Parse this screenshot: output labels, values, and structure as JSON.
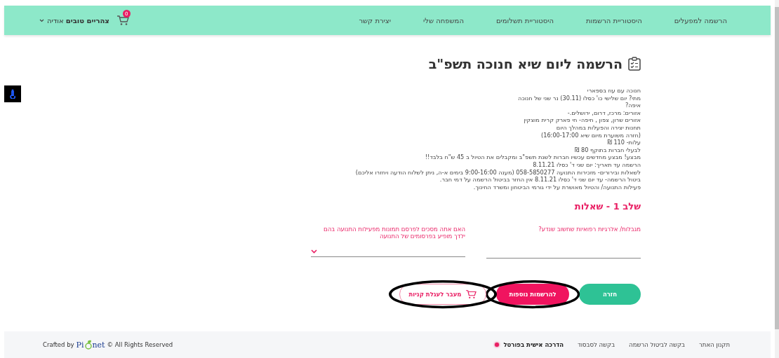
{
  "nav": {
    "items": [
      {
        "label": "הרשמה למפעלים"
      },
      {
        "label": "היסטוריית הרשמות"
      },
      {
        "label": "היסטוריית תשלומים"
      },
      {
        "label": "המשפחה שלי"
      },
      {
        "label": "יצירת קשר"
      }
    ],
    "cart_count": "0",
    "user": {
      "bold": "צהריים טובים",
      "name": "אודיה"
    }
  },
  "title": "הרשמה ליום שיא חנוכה תשפ\"ב",
  "description": [
    "חנוכה עם עוז בספארי",
    "מתי? יום שלישי כו' כסלו (30.11) נר שני של חנוכה",
    "איפה?",
    "אזורים: מרכז, דרום, ירושלים.-",
    "אזורים שרון, צפון , חיפה- חי פארק קרית מוצקין",
    "תחנות יצירה והפעלות במהלך היום",
    "(חזרה משוערת מיום שיא 16:00-17:00)",
    "עלות- 110 ₪",
    "לבעלי חברות בתוקף 80 ₪",
    "מבצע! מבצע מחדשים עכשיו חברות לשנת תשפ\"ב ומקבלים את הטיול ב 45 ש\"ח בלבד!!",
    "הרשמה עד תאריך: יום שני ד' כסלו 8.11.21",
    "לשאלות ובירורים- מזכירות התנועה 058-5850277 (מענה 9:00-16:00 בימים א-ה, ניתן לשלוח הודעה ויחזרו אליכם)",
    "ביטול הרשמה- עד יום שני ד' כסלו 8.11.21 אין החזר בביטול הרשמה על דמי חבר.",
    "פעילות התנועה/ והטיול מאושרת על ידי גורמי הביטחון ומשרד החינוך."
  ],
  "step_title": "שלב 1 - שאלות",
  "questions": [
    {
      "kind": "text",
      "label": "מגבלות/ אלרגיות רפואיות שחשוב שנדע?"
    },
    {
      "kind": "select",
      "label": "האם אתה מסכים לפרסם תמונות מפעילות התנועה בהם ילדך מופיע בפרסומים של התנועה"
    }
  ],
  "buttons": [
    {
      "kind": "back",
      "label": "חזרה",
      "circled": false
    },
    {
      "kind": "more",
      "label": "להרשמות נוספות",
      "circled": true
    },
    {
      "kind": "cart",
      "label": "מעבר לעגלת קניות",
      "circled": true
    }
  ],
  "footer": {
    "links": [
      {
        "label": "תקנון האתר",
        "dot": false
      },
      {
        "label": "בקשה לביטול הרשמה",
        "dot": false
      },
      {
        "label": "בקשה לסבסוד",
        "dot": false
      },
      {
        "label": "הדרכה אישית בפורטל",
        "dot": true
      }
    ],
    "crafted": "Crafted by",
    "logo_start": "Pi",
    "logo_end": "net",
    "rights": "© All Rights Reserved"
  }
}
